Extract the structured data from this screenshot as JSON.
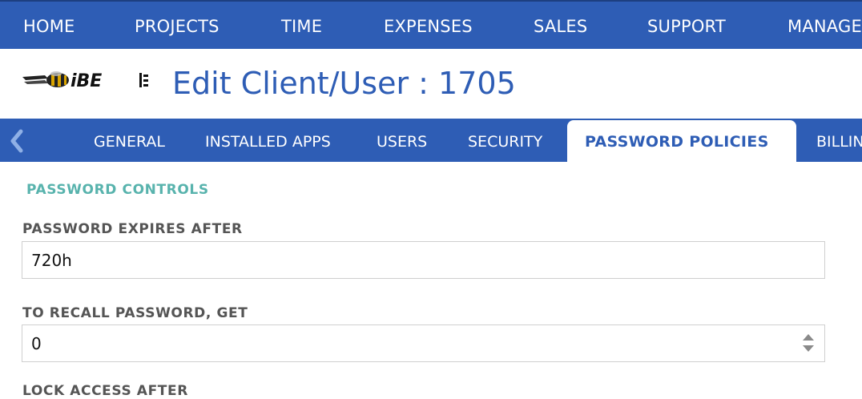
{
  "topnav": {
    "items": [
      {
        "label": "HOME"
      },
      {
        "label": "PROJECTS"
      },
      {
        "label": "TIME"
      },
      {
        "label": "EXPENSES"
      },
      {
        "label": "SALES"
      },
      {
        "label": "SUPPORT"
      },
      {
        "label": "MANAGE"
      }
    ]
  },
  "header": {
    "logo_text": "iBE",
    "title": "Edit Client/User : 1705"
  },
  "tabs": {
    "prev_icon": "chevron-left-icon",
    "items": [
      {
        "label": "GENERAL"
      },
      {
        "label": "INSTALLED APPS"
      },
      {
        "label": "USERS"
      },
      {
        "label": "SECURITY"
      },
      {
        "label": "PASSWORD POLICIES",
        "active": true
      },
      {
        "label": "BILLIN"
      }
    ]
  },
  "form": {
    "section_title": "PASSWORD CONTROLS",
    "fields": [
      {
        "label": "PASSWORD EXPIRES AFTER",
        "value": "720h"
      },
      {
        "label": "TO RECALL PASSWORD, GET",
        "value": "0"
      }
    ],
    "next_label": "LOCK ACCESS AFTER"
  },
  "colors": {
    "brand_blue": "#2e5db5",
    "section_teal": "#58b3ad",
    "label_gray": "#555555"
  }
}
